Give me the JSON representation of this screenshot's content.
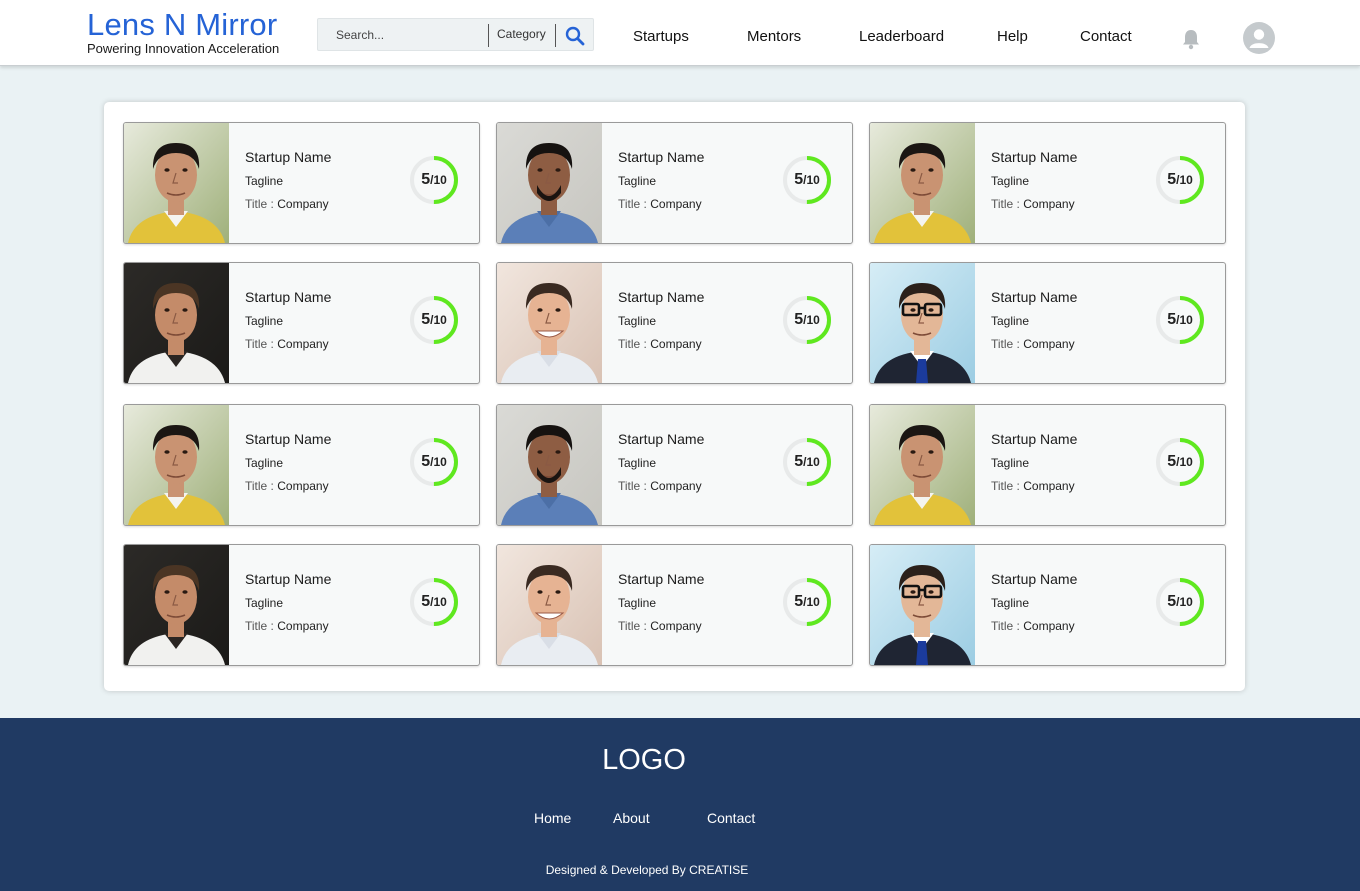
{
  "header": {
    "brand_title": "Lens N Mirror",
    "brand_subtitle": "Powering Innovation Acceleration",
    "search_placeholder": "Search...",
    "category_label": "Category",
    "nav": [
      "Startups",
      "Mentors",
      "Leaderboard",
      "Help",
      "Contact"
    ]
  },
  "colors": {
    "brand_blue": "#2563d6",
    "score_ring": "#5fe81f",
    "footer_bg": "#203a63",
    "page_bg": "#eaf2f4"
  },
  "cards": [
    {
      "name": "Startup Name",
      "tagline": "Tagline",
      "title_label": "Title :",
      "company": "Company",
      "score": "5",
      "score_max": "/10",
      "score_fraction": 0.5,
      "photo": "man-yellow-shirt"
    },
    {
      "name": "Startup Name",
      "tagline": "Tagline",
      "title_label": "Title :",
      "company": "Company",
      "score": "5",
      "score_max": "/10",
      "score_fraction": 0.5,
      "photo": "man-denim-shirt"
    },
    {
      "name": "Startup Name",
      "tagline": "Tagline",
      "title_label": "Title :",
      "company": "Company",
      "score": "5",
      "score_max": "/10",
      "score_fraction": 0.5,
      "photo": "man-yellow-shirt"
    },
    {
      "name": "Startup Name",
      "tagline": "Tagline",
      "title_label": "Title :",
      "company": "Company",
      "score": "5",
      "score_max": "/10",
      "score_fraction": 0.5,
      "photo": "man-dark-background"
    },
    {
      "name": "Startup Name",
      "tagline": "Tagline",
      "title_label": "Title :",
      "company": "Company",
      "score": "5",
      "score_max": "/10",
      "score_fraction": 0.5,
      "photo": "man-smiling"
    },
    {
      "name": "Startup Name",
      "tagline": "Tagline",
      "title_label": "Title :",
      "company": "Company",
      "score": "5",
      "score_max": "/10",
      "score_fraction": 0.5,
      "photo": "man-glasses-suit"
    },
    {
      "name": "Startup Name",
      "tagline": "Tagline",
      "title_label": "Title :",
      "company": "Company",
      "score": "5",
      "score_max": "/10",
      "score_fraction": 0.5,
      "photo": "man-yellow-shirt"
    },
    {
      "name": "Startup Name",
      "tagline": "Tagline",
      "title_label": "Title :",
      "company": "Company",
      "score": "5",
      "score_max": "/10",
      "score_fraction": 0.5,
      "photo": "man-denim-shirt"
    },
    {
      "name": "Startup Name",
      "tagline": "Tagline",
      "title_label": "Title :",
      "company": "Company",
      "score": "5",
      "score_max": "/10",
      "score_fraction": 0.5,
      "photo": "man-yellow-shirt"
    },
    {
      "name": "Startup Name",
      "tagline": "Tagline",
      "title_label": "Title :",
      "company": "Company",
      "score": "5",
      "score_max": "/10",
      "score_fraction": 0.5,
      "photo": "man-dark-background"
    },
    {
      "name": "Startup Name",
      "tagline": "Tagline",
      "title_label": "Title :",
      "company": "Company",
      "score": "5",
      "score_max": "/10",
      "score_fraction": 0.5,
      "photo": "man-smiling"
    },
    {
      "name": "Startup Name",
      "tagline": "Tagline",
      "title_label": "Title :",
      "company": "Company",
      "score": "5",
      "score_max": "/10",
      "score_fraction": 0.5,
      "photo": "man-glasses-suit"
    }
  ],
  "footer": {
    "logo": "LOGO",
    "links": [
      "Home",
      "About",
      "Contact"
    ],
    "credit": "Designed & Developed By CREATISE"
  }
}
